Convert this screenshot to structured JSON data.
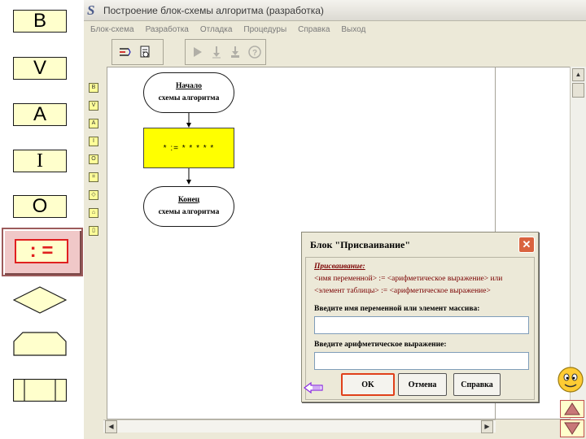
{
  "palette": {
    "input_label": "B",
    "output_label": "V",
    "assign_label": "A",
    "init_label": "I",
    "end_label": "O",
    "assignment_label": ": ="
  },
  "window": {
    "title": "Построение блок-схемы алгоритма (разработка)",
    "app_icon": "S"
  },
  "menu": {
    "items": [
      "Блок-схема",
      "Разработка",
      "Отладка",
      "Процедуры",
      "Справка",
      "Выход"
    ]
  },
  "vtool": {
    "items": [
      "B",
      "V",
      "A",
      "I",
      "O",
      "=",
      "◇",
      "⌂",
      "▯"
    ]
  },
  "flowchart": {
    "start_line1": "Начало",
    "start_line2": "схемы алгоритма",
    "process_text": "* := * * * * *",
    "end_line1": "Конец",
    "end_line2": "схемы алгоритма",
    "process_color": "#ffff00"
  },
  "dialog": {
    "title": "Блок \"Присваивание\"",
    "heading": "Присваивание:",
    "rule1": "<имя переменной> := <арифметическое выражение>  или",
    "rule2": "<элемент таблицы> := <арифметическое выражение>",
    "label_var": "Введите имя переменной или элемент массива:",
    "label_expr": "Введите арифметическое выражение:",
    "var_value": "",
    "expr_value": "",
    "ok": "OK",
    "cancel": "Отмена",
    "help": "Справка"
  },
  "colors": {
    "accent_red": "#e02020",
    "palette_fill": "#ffffcc",
    "window_bg": "#ece9d8"
  }
}
